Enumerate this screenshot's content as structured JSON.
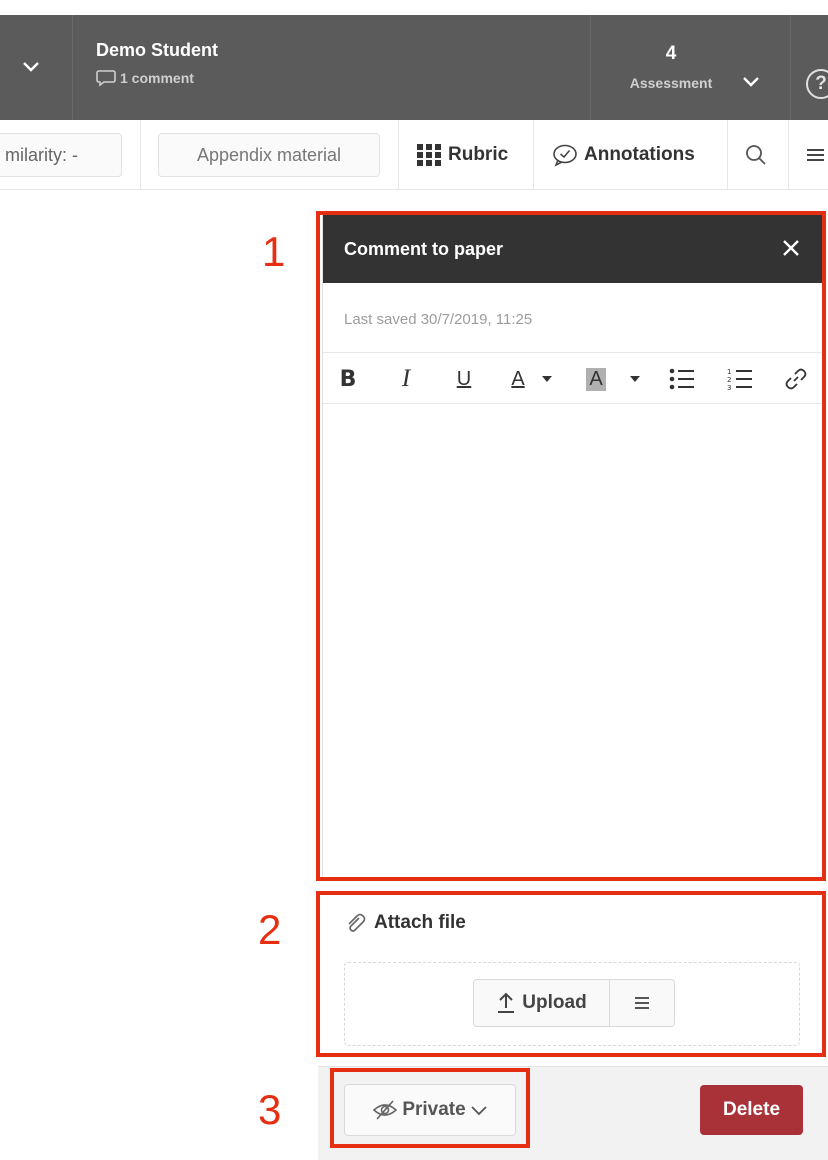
{
  "header": {
    "student_name": "Demo Student",
    "comment_count_label": "1 comment",
    "assessment_value": "4",
    "assessment_label": "Assessment",
    "help_symbol": "?"
  },
  "toolbar": {
    "similarity_label": "milarity: -",
    "appendix_label": "Appendix material",
    "rubric_label": "Rubric",
    "annotations_label": "Annotations"
  },
  "comment_panel": {
    "title": "Comment to paper",
    "last_saved": "Last saved 30/7/2019, 11:25",
    "format_tools": {
      "bold": "B",
      "italic": "I",
      "underline": "U",
      "text_color": "A",
      "highlight": "A"
    },
    "editor_content": ""
  },
  "attachments": {
    "title": "Attach file",
    "upload_label": "Upload"
  },
  "footer": {
    "visibility_label": "Private",
    "delete_label": "Delete"
  },
  "annotations": {
    "marker_1": "1",
    "marker_2": "2",
    "marker_3": "3",
    "color": "#e62e12"
  },
  "colors": {
    "header_bg": "#5b5b5b",
    "panel_header_bg": "#333333",
    "delete_bg": "#a83238"
  }
}
